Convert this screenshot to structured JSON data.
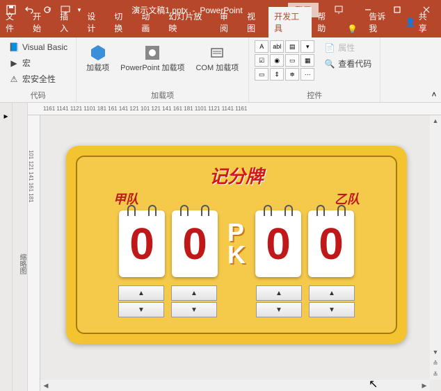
{
  "titlebar": {
    "doc_name": "演示文稿1.pptx",
    "app_name": "PowerPoint",
    "login": "登录"
  },
  "tabs": {
    "file": "文件",
    "home": "开始",
    "insert": "插入",
    "design": "设计",
    "transitions": "切换",
    "animations": "动画",
    "slideshow": "幻灯片放映",
    "review": "审阅",
    "view": "视图",
    "developer": "开发工具",
    "help": "帮助",
    "tellme": "告诉我",
    "share": "共享"
  },
  "ribbon": {
    "vb": "Visual Basic",
    "macro": "宏",
    "macro_security": "宏安全性",
    "code_group": "代码",
    "addins": "加载项",
    "ppt_addins": "PowerPoint 加载项",
    "com_addins": "COM 加载项",
    "addins_group": "加载项",
    "properties": "属性",
    "view_code": "查看代码",
    "controls_group": "控件"
  },
  "slide": {
    "title": "记分牌",
    "team_a": "甲队",
    "team_b": "乙队",
    "pk_p": "P",
    "pk_k": "K",
    "digits": [
      "0",
      "0",
      "0",
      "0"
    ]
  },
  "thumb_label": "缩略图",
  "ruler_h": "1161 1141 1121 1101 181 161 141 121 101 121 141 161 181 1101 1121 1141 1161",
  "ruler_v": "101 121 141 161 181"
}
